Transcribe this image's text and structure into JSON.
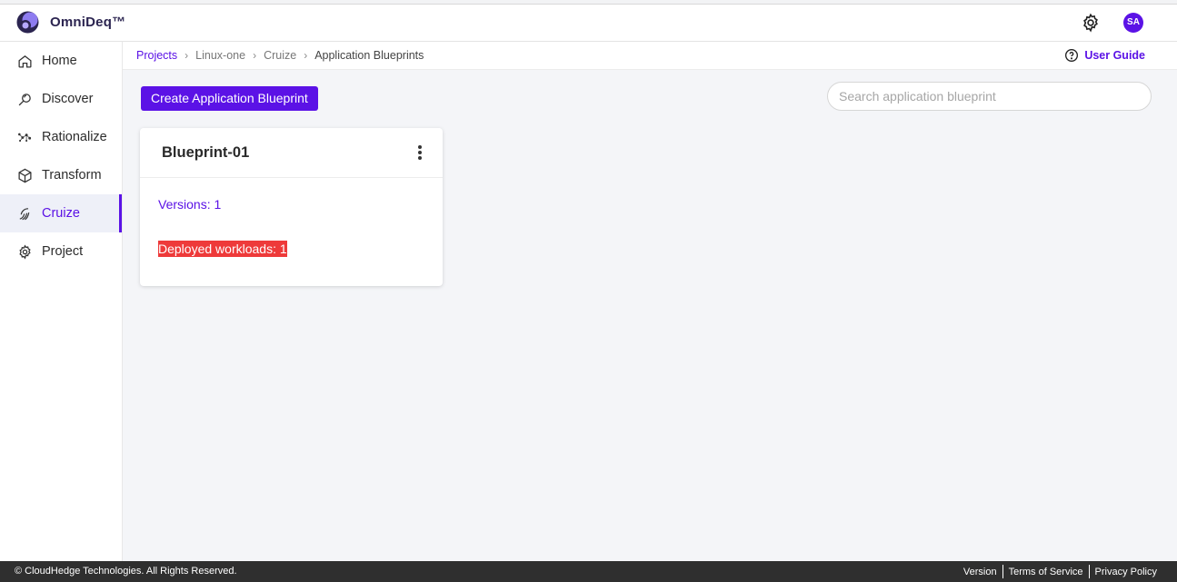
{
  "app": {
    "brand": "OmniDeq™"
  },
  "header": {
    "avatar_initials": "SA"
  },
  "sidebar": {
    "items": [
      {
        "label": "Home",
        "icon": "home-icon"
      },
      {
        "label": "Discover",
        "icon": "discover-icon"
      },
      {
        "label": "Rationalize",
        "icon": "rationalize-icon"
      },
      {
        "label": "Transform",
        "icon": "cube-icon"
      },
      {
        "label": "Cruize",
        "icon": "cruize-icon",
        "active": true
      },
      {
        "label": "Project",
        "icon": "gear-icon"
      }
    ]
  },
  "breadcrumb": {
    "items": [
      "Projects",
      "Linux-one",
      "Cruize",
      "Application Blueprints"
    ]
  },
  "user_guide": {
    "label": "User Guide"
  },
  "toolbar": {
    "create_label": "Create Application Blueprint",
    "search_placeholder": "Search application blueprint",
    "search_value": ""
  },
  "blueprint_card": {
    "title": "Blueprint-01",
    "versions": "Versions: 1",
    "deployed": "Deployed workloads: 1"
  },
  "footer": {
    "copyright": "© CloudHedge Technologies. All Rights Reserved.",
    "links": [
      "Version",
      "Terms of Service",
      "Privacy Policy"
    ]
  },
  "colors": {
    "accent": "#5b12e6",
    "danger": "#ee3a3a",
    "footer_bg": "#2f2f2f"
  }
}
